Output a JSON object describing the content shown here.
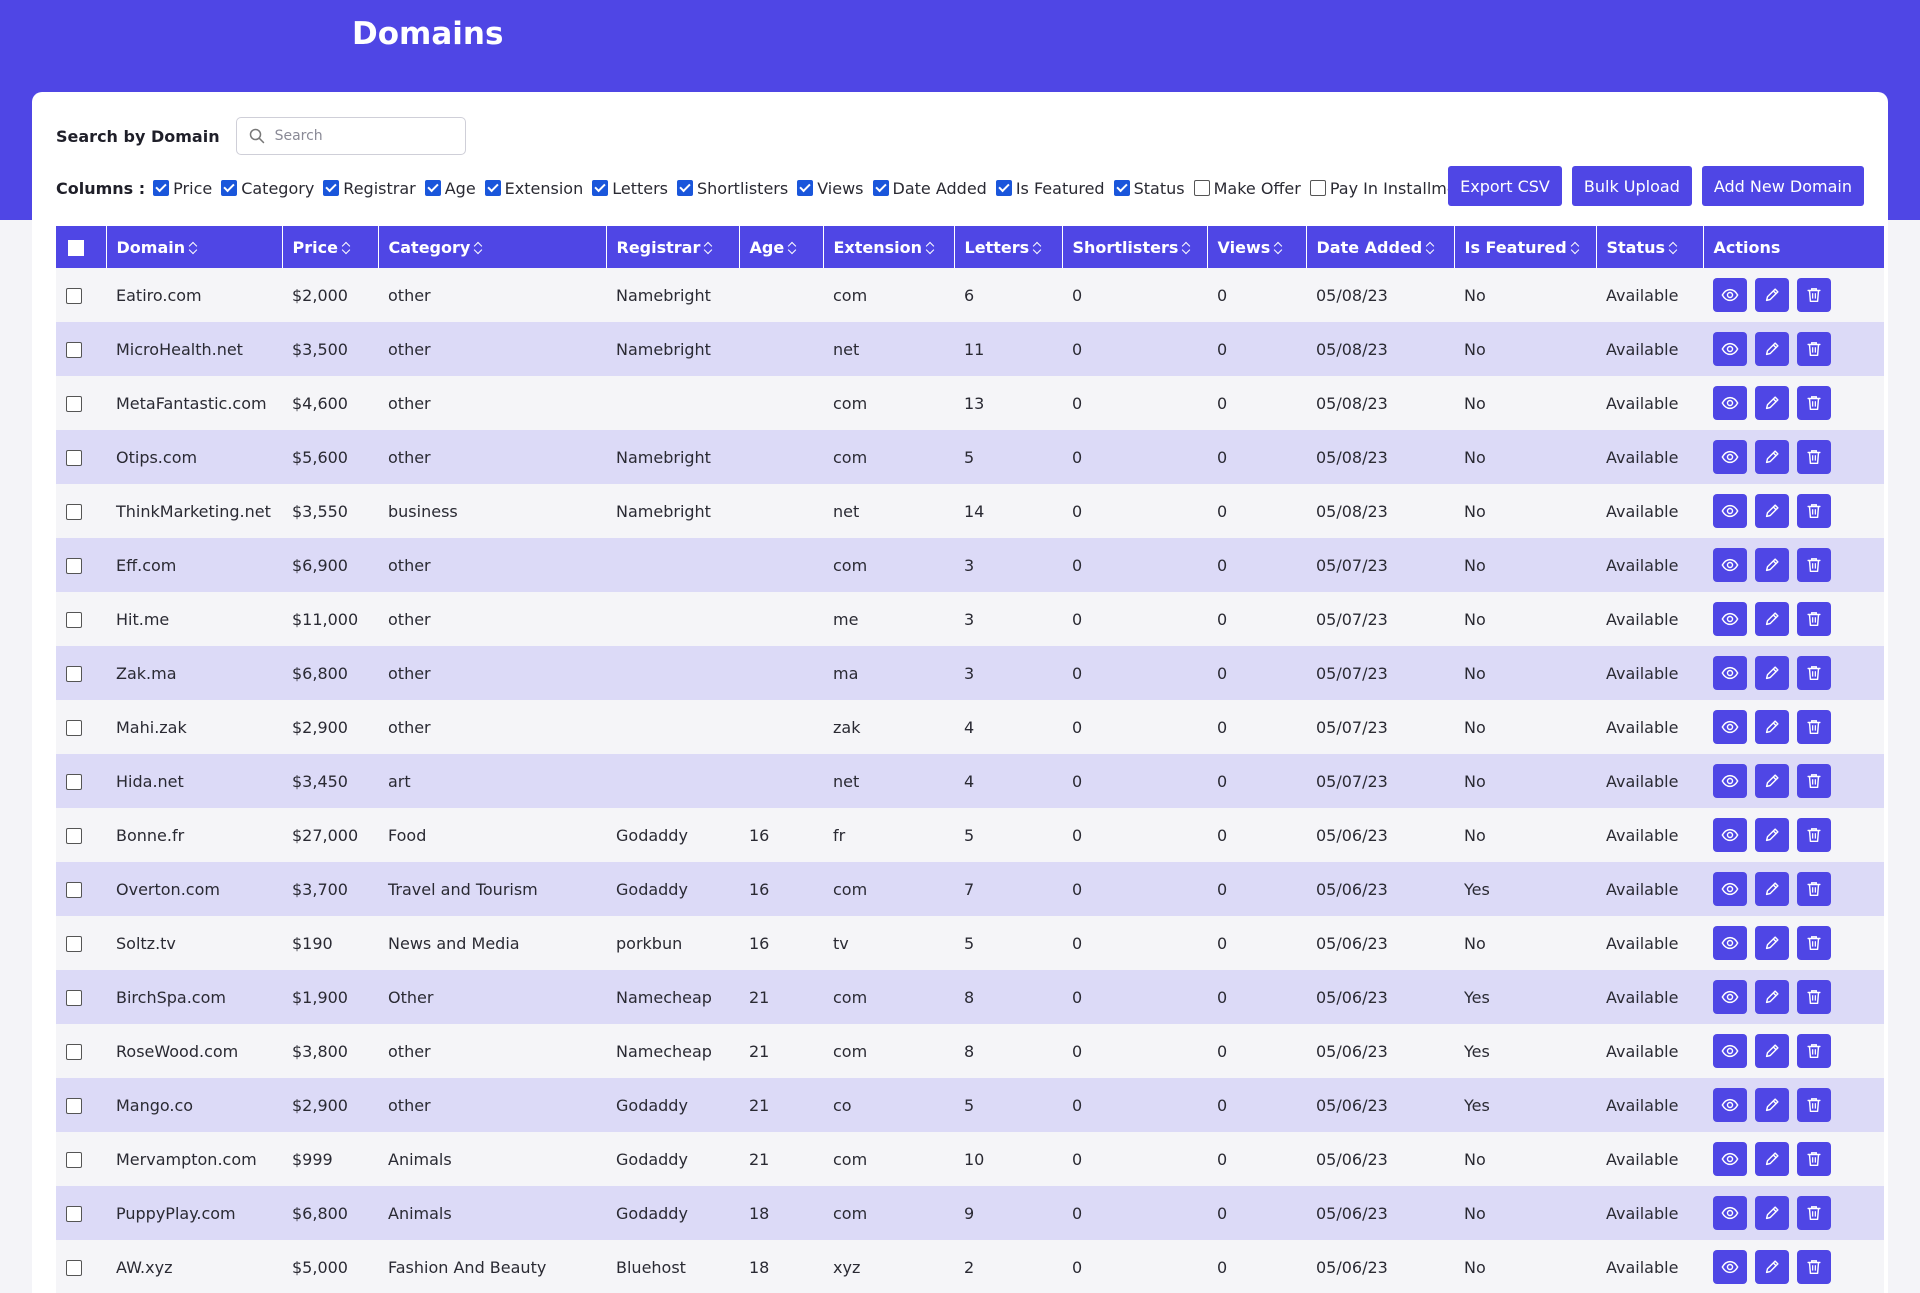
{
  "header": {
    "title": "Domains"
  },
  "search": {
    "label": "Search by Domain",
    "placeholder": "Search",
    "value": ""
  },
  "columns": {
    "label": "Columns :",
    "options": [
      {
        "label": "Price",
        "checked": true
      },
      {
        "label": "Category",
        "checked": true
      },
      {
        "label": "Registrar",
        "checked": true
      },
      {
        "label": "Age",
        "checked": true
      },
      {
        "label": "Extension",
        "checked": true
      },
      {
        "label": "Letters",
        "checked": true
      },
      {
        "label": "Shortlisters",
        "checked": true
      },
      {
        "label": "Views",
        "checked": true
      },
      {
        "label": "Date Added",
        "checked": true
      },
      {
        "label": "Is Featured",
        "checked": true
      },
      {
        "label": "Status",
        "checked": true
      },
      {
        "label": "Make Offer",
        "checked": false
      },
      {
        "label": "Pay In Installments",
        "checked": false
      }
    ]
  },
  "toolbar": {
    "export_label": "Export CSV",
    "bulk_label": "Bulk Upload",
    "add_label": "Add New Domain"
  },
  "table": {
    "headers": [
      "Domain",
      "Price",
      "Category",
      "Registrar",
      "Age",
      "Extension",
      "Letters",
      "Shortlisters",
      "Views",
      "Date Added",
      "Is Featured",
      "Status",
      "Actions"
    ],
    "rows": [
      [
        "Eatiro.com",
        "$2,000",
        "other",
        "Namebright",
        "",
        "com",
        "6",
        "0",
        "0",
        "05/08/23",
        "No",
        "Available"
      ],
      [
        "MicroHealth.net",
        "$3,500",
        "other",
        "Namebright",
        "",
        "net",
        "11",
        "0",
        "0",
        "05/08/23",
        "No",
        "Available"
      ],
      [
        "MetaFantastic.com",
        "$4,600",
        "other",
        "",
        "",
        "com",
        "13",
        "0",
        "0",
        "05/08/23",
        "No",
        "Available"
      ],
      [
        "Otips.com",
        "$5,600",
        "other",
        "Namebright",
        "",
        "com",
        "5",
        "0",
        "0",
        "05/08/23",
        "No",
        "Available"
      ],
      [
        "ThinkMarketing.net",
        "$3,550",
        "business",
        "Namebright",
        "",
        "net",
        "14",
        "0",
        "0",
        "05/08/23",
        "No",
        "Available"
      ],
      [
        "Eff.com",
        "$6,900",
        "other",
        "",
        "",
        "com",
        "3",
        "0",
        "0",
        "05/07/23",
        "No",
        "Available"
      ],
      [
        "Hit.me",
        "$11,000",
        "other",
        "",
        "",
        "me",
        "3",
        "0",
        "0",
        "05/07/23",
        "No",
        "Available"
      ],
      [
        "Zak.ma",
        "$6,800",
        "other",
        "",
        "",
        "ma",
        "3",
        "0",
        "0",
        "05/07/23",
        "No",
        "Available"
      ],
      [
        "Mahi.zak",
        "$2,900",
        "other",
        "",
        "",
        "zak",
        "4",
        "0",
        "0",
        "05/07/23",
        "No",
        "Available"
      ],
      [
        "Hida.net",
        "$3,450",
        "art",
        "",
        "",
        "net",
        "4",
        "0",
        "0",
        "05/07/23",
        "No",
        "Available"
      ],
      [
        "Bonne.fr",
        "$27,000",
        "Food",
        "Godaddy",
        "16",
        "fr",
        "5",
        "0",
        "0",
        "05/06/23",
        "No",
        "Available"
      ],
      [
        "Overton.com",
        "$3,700",
        "Travel and Tourism",
        "Godaddy",
        "16",
        "com",
        "7",
        "0",
        "0",
        "05/06/23",
        "Yes",
        "Available"
      ],
      [
        "Soltz.tv",
        "$190",
        "News and Media",
        "porkbun",
        "16",
        "tv",
        "5",
        "0",
        "0",
        "05/06/23",
        "No",
        "Available"
      ],
      [
        "BirchSpa.com",
        "$1,900",
        "Other",
        "Namecheap",
        "21",
        "com",
        "8",
        "0",
        "0",
        "05/06/23",
        "Yes",
        "Available"
      ],
      [
        "RoseWood.com",
        "$3,800",
        "other",
        "Namecheap",
        "21",
        "com",
        "8",
        "0",
        "0",
        "05/06/23",
        "Yes",
        "Available"
      ],
      [
        "Mango.co",
        "$2,900",
        "other",
        "Godaddy",
        "21",
        "co",
        "5",
        "0",
        "0",
        "05/06/23",
        "Yes",
        "Available"
      ],
      [
        "Mervampton.com",
        "$999",
        "Animals",
        "Godaddy",
        "21",
        "com",
        "10",
        "0",
        "0",
        "05/06/23",
        "No",
        "Available"
      ],
      [
        "PuppyPlay.com",
        "$6,800",
        "Animals",
        "Godaddy",
        "18",
        "com",
        "9",
        "0",
        "0",
        "05/06/23",
        "No",
        "Available"
      ],
      [
        "AW.xyz",
        "$5,000",
        "Fashion And Beauty",
        "Bluehost",
        "18",
        "xyz",
        "2",
        "0",
        "0",
        "05/06/23",
        "No",
        "Available"
      ]
    ]
  },
  "icons": {
    "search": "search-icon",
    "view": "eye-icon",
    "edit": "pencil-icon",
    "delete": "trash-icon"
  },
  "colors": {
    "accent": "#4f46e5",
    "row_alt": "#dcdaf7",
    "row_base": "#f5f5f8",
    "checkbox": "#1a56db"
  }
}
